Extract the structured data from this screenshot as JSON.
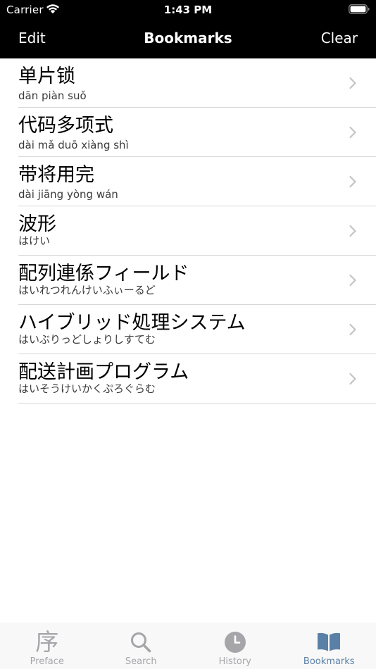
{
  "status_bar": {
    "carrier": "Carrier",
    "time": "1:43 PM"
  },
  "nav": {
    "edit_label": "Edit",
    "title": "Bookmarks",
    "clear_label": "Clear"
  },
  "bookmarks": [
    {
      "term": "单片锁",
      "reading": "dān piàn suǒ"
    },
    {
      "term": "代码多项式",
      "reading": "dài mǎ duō xiàng shì"
    },
    {
      "term": "带将用完",
      "reading": "dài jiāng yòng wán"
    },
    {
      "term": "波形",
      "reading": "はけい"
    },
    {
      "term": "配列連係フィールド",
      "reading": "はいれつれんけいふぃーるど"
    },
    {
      "term": "ハイブリッド処理システム",
      "reading": "はいぶりっどしょりしすてむ"
    },
    {
      "term": "配送計画プログラム",
      "reading": "はいそうけいかくぷろぐらむ"
    }
  ],
  "tabbar": {
    "tabs": [
      {
        "label": "Preface",
        "icon": "preface-kanji-icon",
        "glyph": "序"
      },
      {
        "label": "Search",
        "icon": "magnifier-icon"
      },
      {
        "label": "History",
        "icon": "clock-icon"
      },
      {
        "label": "Bookmarks",
        "icon": "open-book-icon"
      }
    ],
    "active_tab": "Bookmarks"
  },
  "colors": {
    "nav_background": "#000000",
    "tab_active": "#5b80a8",
    "tab_inactive": "#a6a6aa",
    "separator": "#d7d7da"
  }
}
